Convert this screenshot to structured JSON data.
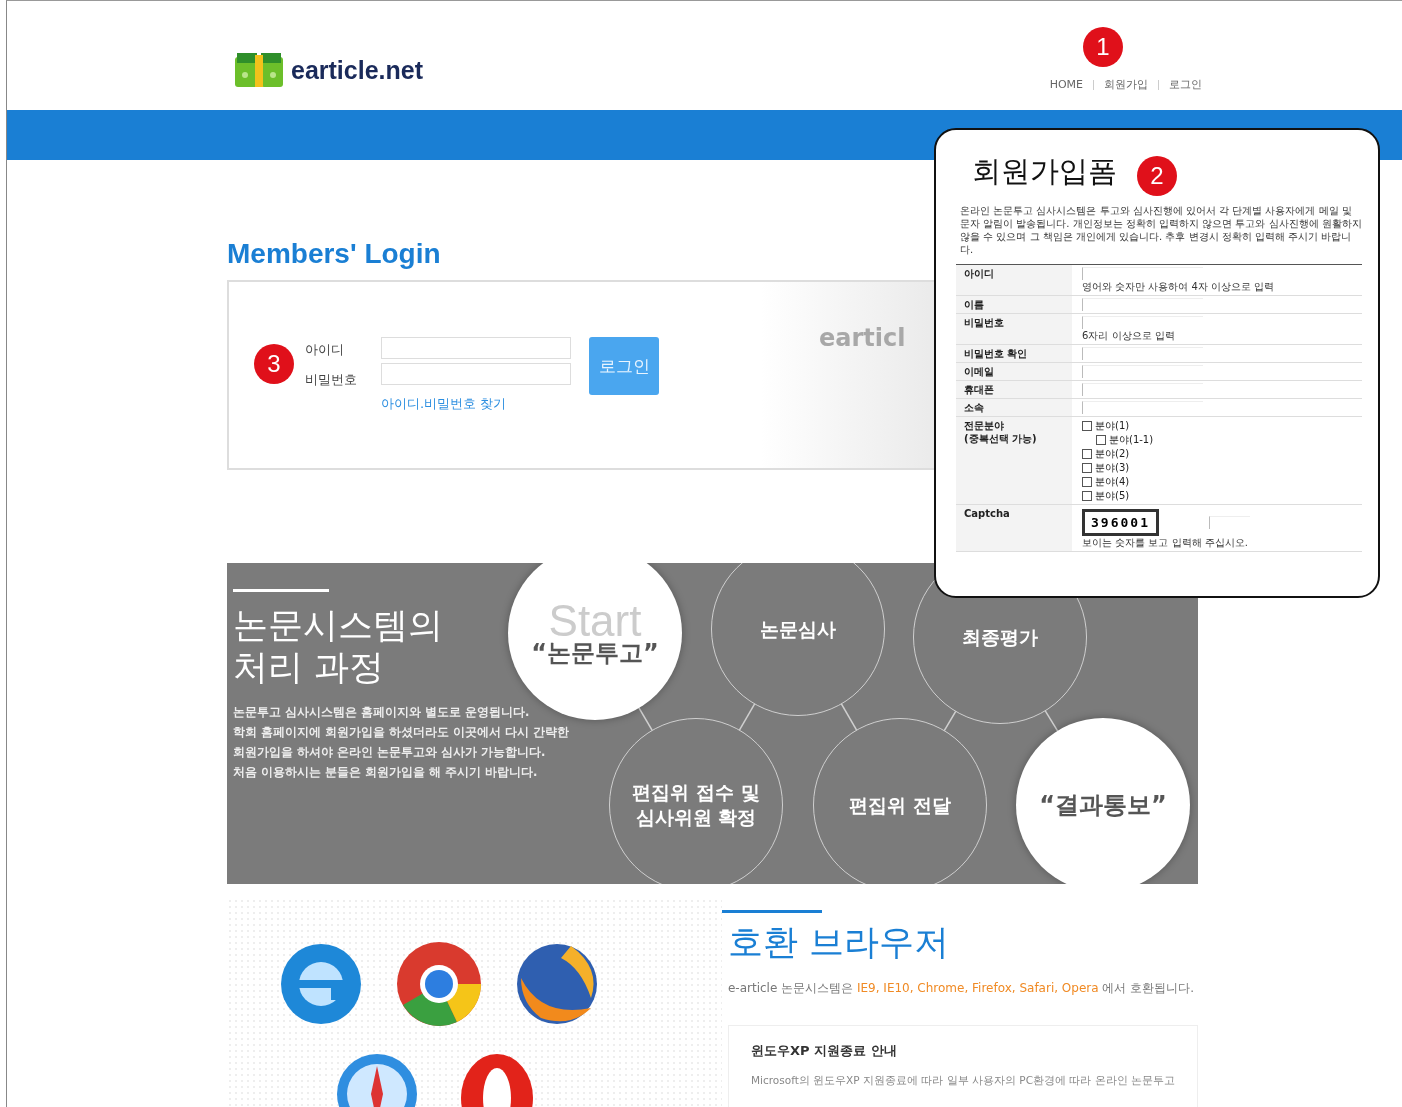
{
  "header": {
    "logo": "earticle.net",
    "nav": [
      {
        "label": "HOME"
      },
      {
        "label": "회원가입"
      },
      {
        "label": "로그인"
      }
    ]
  },
  "login": {
    "title": "Members' Login",
    "fields": [
      {
        "label": "아이디"
      },
      {
        "label": "비밀번호"
      }
    ],
    "button": "로그인",
    "link": "아이디.비밀번호 찾기",
    "watermark": "earticl"
  },
  "process": {
    "title": [
      "논문시스템의",
      "처리 과정"
    ],
    "description": [
      "논문투고 심사시스템은 홈페이지와 별도로 운영됩니다.",
      "학회 홈페이지에 회원가입을 하셨더라도 이곳에서 다시 간략한",
      "회원가입을 하셔야 온라인 논문투고와 심사가 가능합니다.",
      "처음 이용하시는 분들은 회원가입을 해 주시기 바랍니다."
    ],
    "steps": [
      {
        "kind": "highlight",
        "word": "Start",
        "label": [
          "“논문투고”"
        ]
      },
      {
        "kind": "outline",
        "label": [
          "논문심사"
        ]
      },
      {
        "kind": "outline",
        "label": [
          "최종평가"
        ]
      },
      {
        "kind": "outline",
        "label": [
          "편집위 접수 및",
          "심사위원 확정"
        ]
      },
      {
        "kind": "outline",
        "label": [
          "편집위 전달"
        ]
      },
      {
        "kind": "highlight",
        "label": [
          "“결과통보”"
        ]
      }
    ]
  },
  "browsers": {
    "title": "호환 브라우저",
    "description_start": "e-article 논문시스템은 ",
    "description_browsers": "IE9, IE10, Chrome, Firefox, Safari, Opera",
    "description_end": " 에서 호환됩니다.",
    "notice_title": "윈도우XP 지원종료 안내",
    "notice_text": "Microsoft의 윈도우XP 지원종료에 따라 일부 사용자의 PC환경에 따라 온라인 논문투고"
  },
  "popup": {
    "title": "회원가입폼",
    "intro": "온라인 논문투고 심사시스템은 투고와 심사진행에 있어서 각 단계별 사용자에게 메일 및 문자 알림이 발송됩니다. 개인정보는 정확히 입력하지 않으면 투고와 심사진행에 원활하지 않을 수 있으며 그 책임은 개인에게 있습니다. 추후 변경시 정확히 입력해 주시기 바랍니다.",
    "rows": [
      {
        "kind": "text",
        "label": "아이디",
        "hint": "영어와 숫자만 사용하여 4자 이상으로 입력"
      },
      {
        "kind": "text",
        "label": "이름"
      },
      {
        "kind": "text",
        "label": "비밀번호",
        "hint": "6자리 이상으로 입력"
      },
      {
        "kind": "text",
        "label": "비밀번호 확인"
      },
      {
        "kind": "text",
        "label": "이메일"
      },
      {
        "kind": "text",
        "label": "휴대폰"
      },
      {
        "kind": "text",
        "label": "소속"
      },
      {
        "kind": "checkboxes",
        "label": "전문분야",
        "sublabel": "(중복선택 가능)",
        "options": [
          {
            "label": "분야(1)",
            "checked": false,
            "children": [
              {
                "label": "분야(1-1)",
                "checked": false
              }
            ]
          },
          {
            "label": "분야(2)",
            "checked": false
          },
          {
            "label": "분야(3)",
            "checked": false
          },
          {
            "label": "분야(4)",
            "checked": false
          },
          {
            "label": "분야(5)",
            "checked": false
          }
        ]
      },
      {
        "kind": "captcha",
        "label": "Captcha",
        "code": "396001",
        "hint": "보이는 숫자를 보고 입력해 주십시오."
      }
    ]
  },
  "annotations": [
    {
      "label": "1"
    },
    {
      "label": "2"
    },
    {
      "label": "3"
    }
  ]
}
